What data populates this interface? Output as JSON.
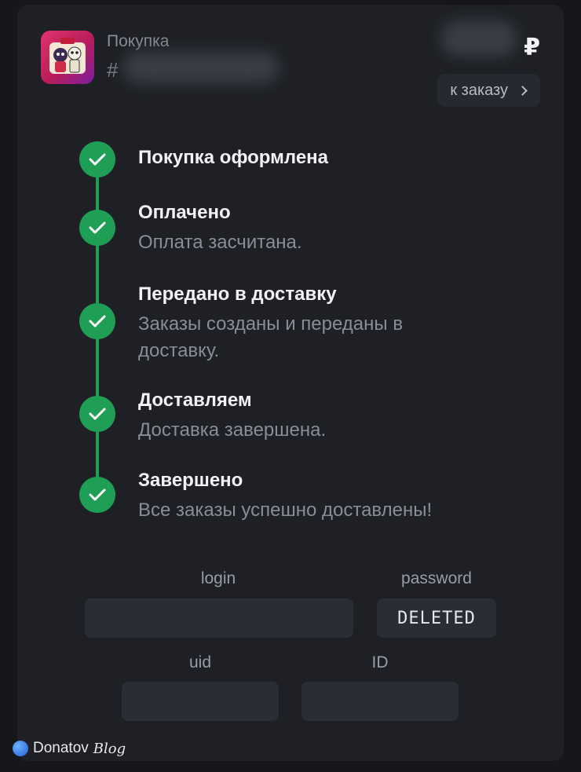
{
  "header": {
    "title": "Покупка",
    "order_prefix": "#",
    "currency": "₽",
    "to_order_label": "к заказу",
    "app_icon": "game-app-icon"
  },
  "steps": [
    {
      "title": "Покупка оформлена",
      "description": ""
    },
    {
      "title": "Оплачено",
      "description": "Оплата засчитана."
    },
    {
      "title": "Передано в доставку",
      "description": "Заказы созданы и переданы в доставку."
    },
    {
      "title": "Доставляем",
      "description": "Доставка завершена."
    },
    {
      "title": "Завершено",
      "description": "Все заказы успешно доставлены!"
    }
  ],
  "fields": {
    "login": {
      "label": "login",
      "value": ""
    },
    "password": {
      "label": "password",
      "value": "DELETED"
    },
    "uid": {
      "label": "uid",
      "value": ""
    },
    "id": {
      "label": "ID",
      "value": ""
    }
  },
  "watermark": {
    "brand": "Donatov",
    "suffix": "Blog"
  },
  "colors": {
    "background": "#15171b",
    "card": "#1e2025",
    "success": "#1f9e55",
    "field": "#2a2d33"
  }
}
